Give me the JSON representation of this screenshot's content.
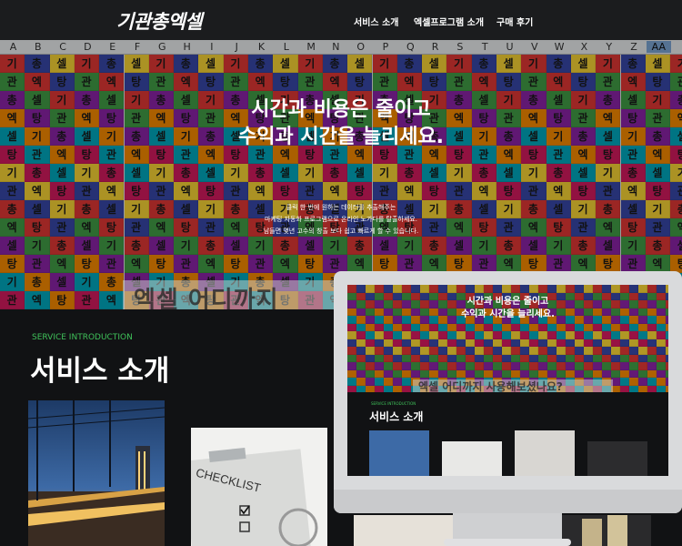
{
  "nav": {
    "logo": "기관총엑셀",
    "items": [
      "서비스 소개",
      "엑셀프로그램 소개",
      "구매 후기"
    ]
  },
  "spreadsheet": {
    "columns": [
      "A",
      "B",
      "C",
      "D",
      "E",
      "F",
      "G",
      "H",
      "I",
      "J",
      "K",
      "L",
      "M",
      "N",
      "O",
      "P",
      "Q",
      "R",
      "S",
      "T",
      "U",
      "V",
      "W",
      "X",
      "Y",
      "Z",
      "AA"
    ],
    "selected_column": "AA",
    "cell_words": [
      "기",
      "관",
      "총",
      "엑",
      "셀",
      "탕"
    ],
    "colors": [
      "#e53935",
      "#fb8c00",
      "#fdd835",
      "#43a047",
      "#00acc1",
      "#3949ab",
      "#8e24aa",
      "#d81b60"
    ]
  },
  "hero": {
    "title_line1": "시간과 비용은 줄이고",
    "title_line2": "수익과 시간을 늘리세요.",
    "desc_line1": "클릭 한 번에 원하는 데이터를 추출해주는",
    "desc_line2": "마케팅 자동화 프로그램으로 온라인 노가다를 탈출하세요.",
    "desc_line3": "남들면 몇년 고수의 창출 보다 쉽고 빠르게 할 수 있습니다.",
    "banner": "엑셀 어디까지"
  },
  "service": {
    "eyebrow": "SERVICE INTRODUCTION",
    "title": "서비스 소개",
    "cards": [
      "train-station-photo",
      "checklist-photo",
      "notebook-photo",
      "coins-photo"
    ]
  },
  "monitor": {
    "title_line1": "시간과 비용은 줄이고",
    "title_line2": "수익과 시간을 늘리세요.",
    "banner": "엑셀 어디까지 사용해보셨나요?",
    "eyebrow": "SERVICE INTRODUCTION",
    "title": "서비스 소개"
  }
}
